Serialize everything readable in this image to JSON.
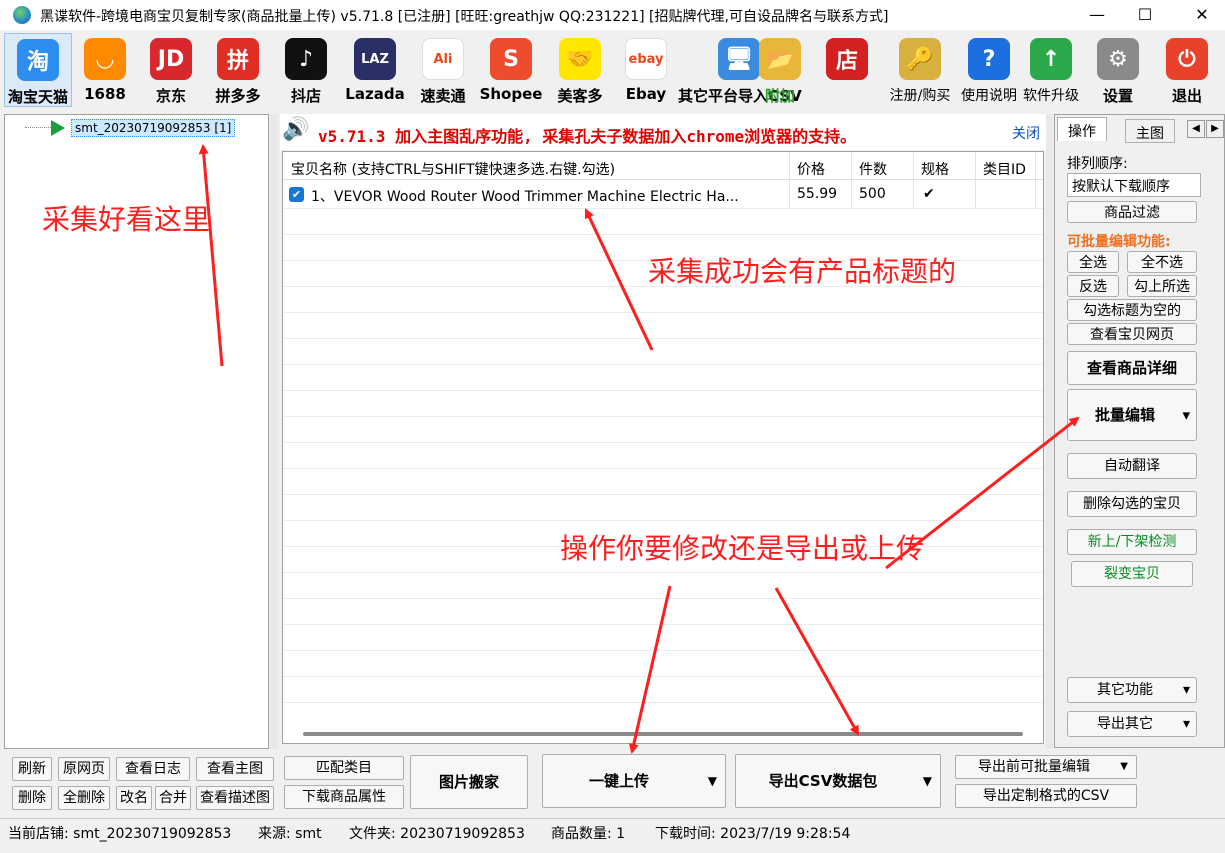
{
  "window": {
    "title": "黑谍软件-跨境电商宝贝复制专家(商品批量上传)  v5.71.8 [已注册] [旺旺:greathjw QQ:231221] [招贴牌代理,可自设品牌名与联系方式]",
    "minimize": "—",
    "maximize": "☐",
    "close": "✕"
  },
  "toolbar": [
    {
      "label": "淘宝天猫",
      "icon": "taobao-icon",
      "glyph": "淘",
      "color": "#2d8ef0"
    },
    {
      "label": "1688",
      "icon": "1688-icon",
      "glyph": "◡",
      "color": "#ff8a00"
    },
    {
      "label": "京东",
      "icon": "jd-icon",
      "glyph": "JD",
      "color": "#d9272e"
    },
    {
      "label": "拼多多",
      "icon": "pinduoduo-icon",
      "glyph": "拼",
      "color": "#e02e24"
    },
    {
      "label": "抖店",
      "icon": "douyin-icon",
      "glyph": "♪",
      "color": "#111111"
    },
    {
      "label": "Lazada",
      "icon": "lazada-icon",
      "glyph": "LAZ",
      "color": "#2a2f66"
    },
    {
      "label": "速卖通",
      "icon": "aliexpress-icon",
      "glyph": "Ali",
      "color": "#ffffff"
    },
    {
      "label": "Shopee",
      "icon": "shopee-icon",
      "glyph": "S",
      "color": "#ee4d2d"
    },
    {
      "label": "美客多",
      "icon": "mercadolibre-icon",
      "glyph": "🤝",
      "color": "#ffe600"
    },
    {
      "label": "Ebay",
      "icon": "ebay-icon",
      "glyph": "ebay",
      "color": "#ffffff"
    },
    {
      "label": "其它平台导入CSV",
      "icon": "monitor-globe-icon",
      "glyph": "🖥",
      "color": "#3a8be0"
    },
    {
      "label": "附加",
      "icon": "folder-plus-icon",
      "glyph": "📂",
      "color": "#e8b73a"
    },
    {
      "label": "店",
      "icon": "shop-icon",
      "glyph": "店",
      "color": "#d32020"
    },
    {
      "label": "注册/购买",
      "icon": "keys-icon",
      "glyph": "🔑",
      "color": "#d8b040"
    },
    {
      "label": "使用说明",
      "icon": "help-icon",
      "glyph": "?",
      "color": "#1d6ee0"
    },
    {
      "label": "软件升级",
      "icon": "upgrade-icon",
      "glyph": "↑",
      "color": "#2aa84a"
    },
    {
      "label": "设置",
      "icon": "gear-icon",
      "glyph": "⚙",
      "color": "#8a8a8a"
    },
    {
      "label": "退出",
      "icon": "power-icon",
      "glyph": "⏻",
      "color": "#e8432a"
    }
  ],
  "tree": {
    "node": "smt_20230719092853 [1]"
  },
  "annotations": {
    "left": "采集好看这里",
    "center": "采集成功会有产品标题的",
    "bottom": "操作你要修改还是导出或上传"
  },
  "notice": {
    "text": "v5.71.3 加入主图乱序功能, 采集孔夫子数据加入chrome浏览器的支持。",
    "close": "关闭"
  },
  "grid": {
    "columns": [
      "宝贝名称 (支持CTRL与SHIFT键快速多选.右键.勾选)",
      "价格",
      "件数",
      "规格",
      "类目ID"
    ],
    "rows": [
      {
        "name": "1、VEVOR Wood Router Wood Trimmer Machine Electric Ha...",
        "price": "55.99",
        "qty": "500",
        "spec": "✔",
        "category": "",
        "checked": true
      }
    ]
  },
  "right_panel": {
    "tabs": [
      "操作",
      "主图"
    ],
    "sort_label": "排列顺序:",
    "sort_value": "按默认下载顺序",
    "filter_button": "商品过滤",
    "batch_title": "可批量编辑功能:",
    "select_all": "全选",
    "select_none": "全不选",
    "invert": "反选",
    "check_selected": "勾上所选",
    "check_empty_title": "勾选标题为空的",
    "view_page": "查看宝贝网页",
    "view_detail": "查看商品详细",
    "batch_edit": "批量编辑",
    "auto_translate": "自动翻译",
    "delete_checked": "删除勾选的宝贝",
    "listing_check": "新上/下架检测",
    "clone": "裂变宝贝",
    "other_functions": "其它功能",
    "export_other": "导出其它"
  },
  "bottom": {
    "refresh": "刷新",
    "original_page": "原网页",
    "view_log": "查看日志",
    "view_main_image": "查看主图",
    "delete": "删除",
    "delete_all": "全删除",
    "rename": "改名",
    "merge": "合并",
    "view_desc_image": "查看描述图",
    "match_category": "匹配类目",
    "download_attributes": "下载商品属性",
    "move_images": "图片搬家",
    "one_click_upload": "一键上传",
    "export_csv": "导出CSV数据包",
    "export_batch_edit": "导出前可批量编辑",
    "export_custom_csv": "导出定制格式的CSV"
  },
  "status": {
    "store": "当前店铺: smt_20230719092853",
    "source": "来源: smt",
    "folder": "文件夹: 20230719092853",
    "count": "商品数量: 1",
    "download_time": "下载时间: 2023/7/19 9:28:54"
  }
}
